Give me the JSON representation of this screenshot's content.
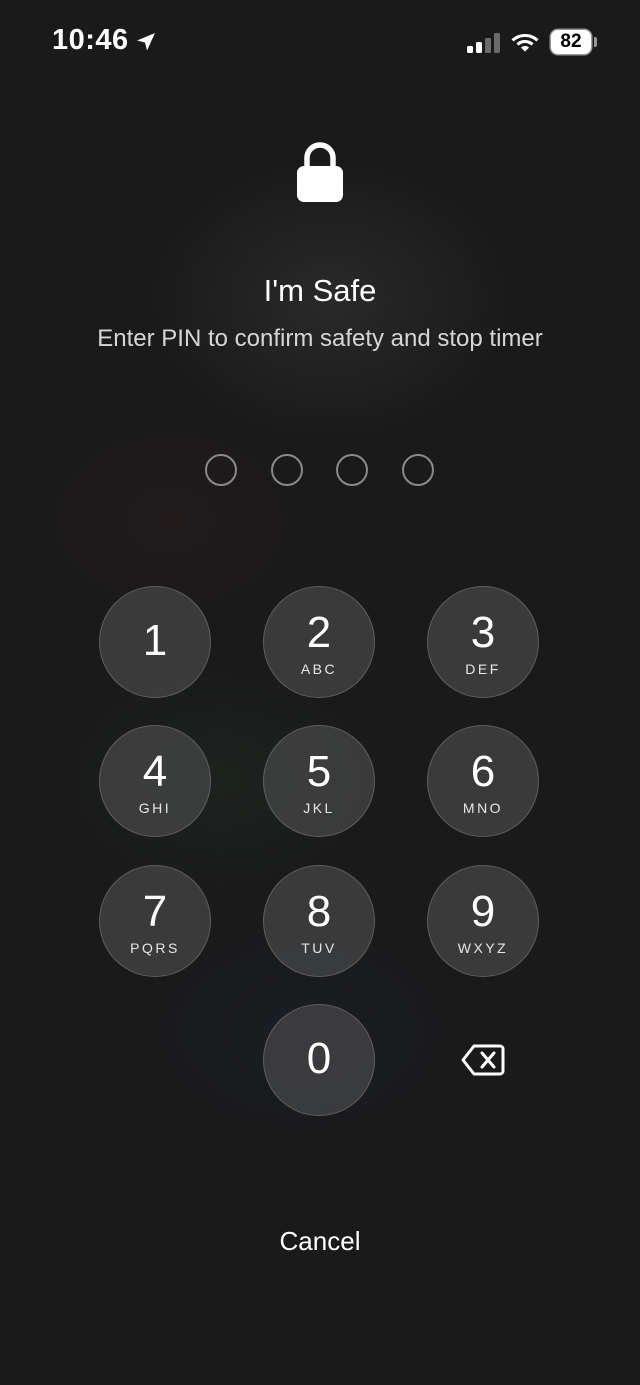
{
  "status_bar": {
    "time": "10:46",
    "battery_level": "82",
    "icons": [
      "location-arrow-icon",
      "cellular-signal-icon",
      "wifi-icon",
      "battery-icon"
    ]
  },
  "header": {
    "icon": "lock-icon",
    "title": "I'm Safe",
    "subtitle": "Enter PIN to confirm safety and stop timer"
  },
  "pin": {
    "length": 4,
    "entered": 0
  },
  "keypad": {
    "keys": [
      {
        "digit": "1",
        "letters": ""
      },
      {
        "digit": "2",
        "letters": "ABC"
      },
      {
        "digit": "3",
        "letters": "DEF"
      },
      {
        "digit": "4",
        "letters": "GHI"
      },
      {
        "digit": "5",
        "letters": "JKL"
      },
      {
        "digit": "6",
        "letters": "MNO"
      },
      {
        "digit": "7",
        "letters": "PQRS"
      },
      {
        "digit": "8",
        "letters": "TUV"
      },
      {
        "digit": "9",
        "letters": "WXYZ"
      },
      {
        "digit": "0",
        "letters": ""
      }
    ],
    "delete_icon": "backspace-icon"
  },
  "actions": {
    "cancel_label": "Cancel"
  }
}
